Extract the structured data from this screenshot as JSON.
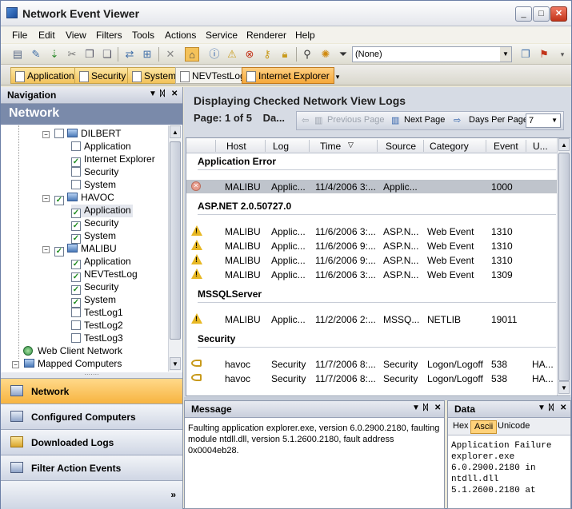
{
  "window": {
    "title": "Network Event Viewer",
    "min_label": "_",
    "max_label": "□",
    "close_label": "✕"
  },
  "menu": [
    "File",
    "Edit",
    "View",
    "Filters",
    "Tools",
    "Actions",
    "Service",
    "Renderer",
    "Help"
  ],
  "toolbar": {
    "filter_value": "(None)"
  },
  "log_tabs": [
    {
      "label": "Application",
      "style": "highlight"
    },
    {
      "label": "Security",
      "style": "highlight"
    },
    {
      "label": "System",
      "style": "highlight"
    },
    {
      "label": "NEVTestLog",
      "style": "plain"
    },
    {
      "label": "Internet Explorer",
      "style": "active"
    }
  ],
  "navigation": {
    "panel_title": "Navigation",
    "network_title": "Network",
    "tree": [
      {
        "label": "DILBERT",
        "level": 0,
        "type": "computer",
        "checked": false,
        "expander": "−"
      },
      {
        "label": "Application",
        "level": 1,
        "type": "log",
        "checked": false
      },
      {
        "label": "Internet Explorer",
        "level": 1,
        "type": "log",
        "checked": true
      },
      {
        "label": "Security",
        "level": 1,
        "type": "log",
        "checked": false
      },
      {
        "label": "System",
        "level": 1,
        "type": "log",
        "checked": false
      },
      {
        "label": "HAVOC",
        "level": 0,
        "type": "computer",
        "checked": true,
        "expander": "−"
      },
      {
        "label": "Application",
        "level": 1,
        "type": "log",
        "checked": true,
        "selected": true
      },
      {
        "label": "Security",
        "level": 1,
        "type": "log",
        "checked": true
      },
      {
        "label": "System",
        "level": 1,
        "type": "log",
        "checked": true
      },
      {
        "label": "MALIBU",
        "level": 0,
        "type": "computer",
        "checked": true,
        "expander": "−"
      },
      {
        "label": "Application",
        "level": 1,
        "type": "log",
        "checked": true
      },
      {
        "label": "NEVTestLog",
        "level": 1,
        "type": "log",
        "checked": true
      },
      {
        "label": "Security",
        "level": 1,
        "type": "log",
        "checked": true
      },
      {
        "label": "System",
        "level": 1,
        "type": "log",
        "checked": true
      },
      {
        "label": "TestLog1",
        "level": 1,
        "type": "log",
        "checked": false
      },
      {
        "label": "TestLog2",
        "level": 1,
        "type": "log",
        "checked": false
      },
      {
        "label": "TestLog3",
        "level": 1,
        "type": "log",
        "checked": false
      },
      {
        "label": "Web Client Network",
        "level": -1,
        "type": "web"
      },
      {
        "label": "Mapped Computers",
        "level": -1,
        "type": "mapped",
        "expander": "−"
      }
    ],
    "sections": [
      {
        "label": "Network",
        "selected": true
      },
      {
        "label": "Configured Computers",
        "selected": false
      },
      {
        "label": "Downloaded Logs",
        "selected": false
      },
      {
        "label": "Filter Action Events",
        "selected": false
      }
    ],
    "more_label": "»"
  },
  "main": {
    "heading": "Displaying Checked Network View Logs",
    "page_info": "Page: 1 of 5",
    "page_extra": "Da...",
    "prev_page": "Previous Page",
    "next_page": "Next Page",
    "days_per_page_label": "Days Per Page",
    "days_per_page_value": "7",
    "columns": [
      "Host",
      "Log",
      "Time",
      "Source",
      "Category",
      "Event",
      "U..."
    ],
    "groups": [
      {
        "name": "Application Error",
        "rows": [
          {
            "icon": "error",
            "host": "MALIBU",
            "log": "Applic...",
            "time": "11/4/2006 3:...",
            "source": "Applic...",
            "category": "",
            "event": "1000",
            "user": "",
            "selected": true
          }
        ]
      },
      {
        "name": "ASP.NET 2.0.50727.0",
        "rows": [
          {
            "icon": "warning",
            "host": "MALIBU",
            "log": "Applic...",
            "time": "11/6/2006 3:...",
            "source": "ASP.N...",
            "category": "Web Event",
            "event": "1310",
            "user": ""
          },
          {
            "icon": "warning",
            "host": "MALIBU",
            "log": "Applic...",
            "time": "11/6/2006 9:...",
            "source": "ASP.N...",
            "category": "Web Event",
            "event": "1310",
            "user": ""
          },
          {
            "icon": "warning",
            "host": "MALIBU",
            "log": "Applic...",
            "time": "11/6/2006 9:...",
            "source": "ASP.N...",
            "category": "Web Event",
            "event": "1310",
            "user": ""
          },
          {
            "icon": "warning",
            "host": "MALIBU",
            "log": "Applic...",
            "time": "11/6/2006 3:...",
            "source": "ASP.N...",
            "category": "Web Event",
            "event": "1309",
            "user": ""
          }
        ]
      },
      {
        "name": "MSSQLServer",
        "rows": [
          {
            "icon": "warning",
            "host": "MALIBU",
            "log": "Applic...",
            "time": "11/2/2006 2:...",
            "source": "MSSQ...",
            "category": "NETLIB",
            "event": "19011",
            "user": ""
          }
        ]
      },
      {
        "name": "Security",
        "rows": [
          {
            "icon": "key",
            "host": "havoc",
            "log": "Security",
            "time": "11/7/2006 8:...",
            "source": "Security",
            "category": "Logon/Logoff",
            "event": "538",
            "user": "HA..."
          },
          {
            "icon": "key",
            "host": "havoc",
            "log": "Security",
            "time": "11/7/2006 8:...",
            "source": "Security",
            "category": "Logon/Logoff",
            "event": "538",
            "user": "HA..."
          }
        ]
      }
    ]
  },
  "message_panel": {
    "title": "Message",
    "text": "Faulting application explorer.exe, version 6.0.2900.2180, faulting module ntdll.dll, version 5.1.2600.2180, fault address 0x0004eb28."
  },
  "data_panel": {
    "title": "Data",
    "tabs": [
      "Hex",
      "Ascii",
      "Unicode"
    ],
    "active_tab": "Ascii",
    "text": "Application Failure\nexplorer.exe\n6.0.2900.2180 in\nntdll.dll\n5.1.2600.2180 at"
  }
}
